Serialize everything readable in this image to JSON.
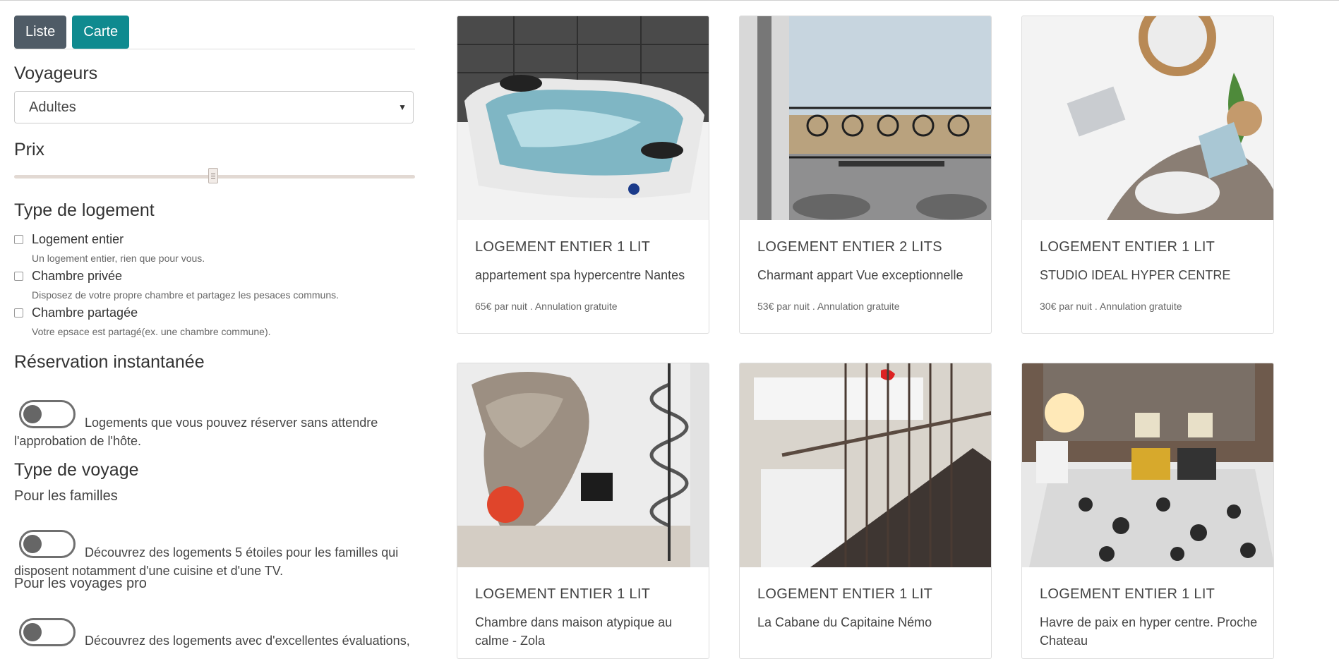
{
  "view_toggle": {
    "list_label": "Liste",
    "map_label": "Carte"
  },
  "travelers": {
    "title": "Voyageurs",
    "select_value": "Adultes"
  },
  "price": {
    "title": "Prix",
    "slider_value_fraction": 0.5
  },
  "lodging_type": {
    "title": "Type de logement",
    "options": [
      {
        "label": "Logement entier",
        "description": "Un logement entier, rien que pour vous."
      },
      {
        "label": "Chambre privée",
        "description": "Disposez de votre propre chambre et partagez les pesaces communs."
      },
      {
        "label": "Chambre partagée",
        "description": "Votre epsace est partagé(ex. une chambre commune)."
      }
    ]
  },
  "instant_booking": {
    "title": "Réservation instantanée",
    "toggle_line1": "Logements que vous pouvez réserver sans attendre",
    "toggle_line2": "l'approbation de l'hôte."
  },
  "trip_type": {
    "title": "Type de voyage",
    "families": {
      "title": "Pour les familles",
      "line1": "Découvrez des logements 5 étoiles pour les familles qui",
      "line2": "disposent notamment d'une cuisine et d'une TV."
    },
    "business": {
      "title": "Pour les voyages pro",
      "line1": "Découvrez des logements avec d'excellentes évaluations,"
    }
  },
  "listings": [
    {
      "type": "LOGEMENT ENTIER 1 LIT",
      "name": "appartement spa hypercentre Nantes",
      "price_info": "65€ par nuit . Annulation gratuite"
    },
    {
      "type": "LOGEMENT ENTIER 2 LITS",
      "name": "Charmant appart Vue exceptionnelle",
      "price_info": "53€ par nuit . Annulation gratuite"
    },
    {
      "type": "LOGEMENT ENTIER 1 LIT",
      "name": "STUDIO IDEAL HYPER CENTRE",
      "price_info": "30€ par nuit . Annulation gratuite"
    },
    {
      "type": "LOGEMENT ENTIER 1 LIT",
      "name": "Chambre dans maison atypique au calme - Zola",
      "price_info": ""
    },
    {
      "type": "LOGEMENT ENTIER 1 LIT",
      "name": "La Cabane du Capitaine Némo",
      "price_info": ""
    },
    {
      "type": "LOGEMENT ENTIER 1 LIT",
      "name": "Havre de paix en hyper centre. Proche Chateau",
      "price_info": ""
    }
  ],
  "colors": {
    "list_button": "#4f5b66",
    "map_button": "#0f8a8f"
  }
}
